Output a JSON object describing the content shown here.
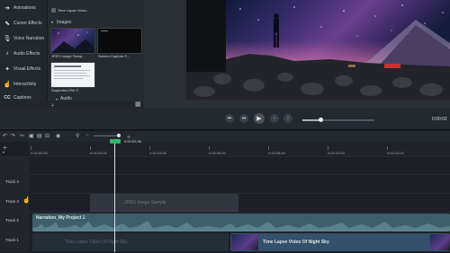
{
  "sidebar": {
    "items": [
      {
        "label": "Animations",
        "icon": "animations-icon"
      },
      {
        "label": "Cursor Effects",
        "icon": "cursor-icon"
      },
      {
        "label": "Voice Narration",
        "icon": "microphone-icon"
      },
      {
        "label": "Audio Effects",
        "icon": "audio-effects-icon"
      },
      {
        "label": "Visual Effects",
        "icon": "visual-effects-icon"
      },
      {
        "label": "Interactivity",
        "icon": "interactivity-icon"
      },
      {
        "label": "Captions",
        "icon": "captions-icon"
      }
    ]
  },
  "bin": {
    "top_caption": "Time Lapse Video...",
    "images_section": "Images",
    "thumb1_caption": "JPEG Image Samp...",
    "thumb2_caption": "Screen-Capture-F...",
    "thumb3_caption": "Supported-File-F...",
    "audio_section": "Audio"
  },
  "controls": {
    "time_display": "0:00:02"
  },
  "ruler": {
    "playhead_time": "0:00:02;26",
    "ticks": [
      "0:00:00;00",
      "0:00:02;00",
      "0:00:04;00",
      "0:00:06;00",
      "0:00:08;00",
      "0:00:10;00",
      "0:00:12;00"
    ]
  },
  "tracks": {
    "labels": [
      "Track 4",
      "Track 3",
      "Track 2",
      "Track 1"
    ],
    "track3_clip": "JPEG Image Sample",
    "track2_clip": "Narration_My Project 1",
    "track1_clip_ghost": "Time Lapse Video Of Night Sky",
    "track1_clip": "Time Lapse Video Of Night Sky"
  },
  "colors": {
    "accent_green": "#2fb36a",
    "narration_clip": "#3c5f6b",
    "video_clip": "#34506a"
  }
}
